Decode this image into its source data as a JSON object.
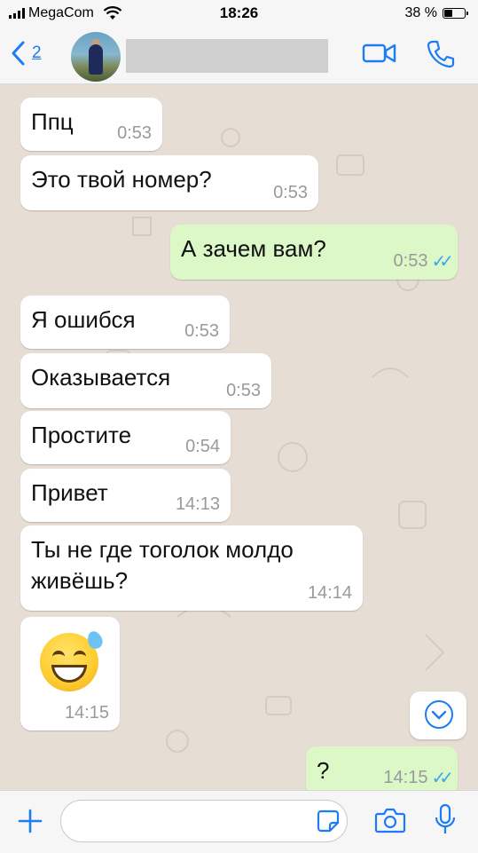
{
  "status_bar": {
    "carrier": "MegaCom",
    "time": "18:26",
    "battery": "38 %",
    "battery_level": 0.38
  },
  "header": {
    "back_count": "2",
    "icons": [
      "chevron-left-icon",
      "video-call-icon",
      "phone-icon"
    ],
    "accent_color": "#1c7cf4"
  },
  "messages": [
    {
      "direction": "in",
      "text": "Ппц",
      "time": "0:53"
    },
    {
      "direction": "in",
      "text": "Это твой номер?",
      "time": "0:53"
    },
    {
      "direction": "out",
      "text": "А зачем вам?",
      "time": "0:53",
      "status": "read"
    },
    {
      "direction": "in",
      "text": "Я ошибся",
      "time": "0:53"
    },
    {
      "direction": "in",
      "text": "Оказывается",
      "time": "0:53"
    },
    {
      "direction": "in",
      "text": "Простите",
      "time": "0:54"
    },
    {
      "direction": "in",
      "text": "Привет",
      "time": "14:13"
    },
    {
      "direction": "in",
      "text": "Ты не где тоголок молдо\nживёшь?",
      "time": "14:14"
    },
    {
      "direction": "in",
      "text": "",
      "emoji": "grinning-face-with-sweat-emoji",
      "time": "14:15"
    },
    {
      "direction": "out",
      "text": "?",
      "time": "14:15",
      "status": "read"
    }
  ],
  "colors": {
    "incoming_bubble": "#ffffff",
    "outgoing_bubble": "#dcf8c6",
    "chat_background": "#e6ddd4",
    "read_ticks": "#3da5f4"
  },
  "input": {
    "value": "",
    "placeholder": "",
    "icons": [
      "plus-icon",
      "sticker-icon",
      "camera-icon",
      "microphone-icon"
    ]
  },
  "scroll_down_icon": "chevron-down-circle-icon"
}
